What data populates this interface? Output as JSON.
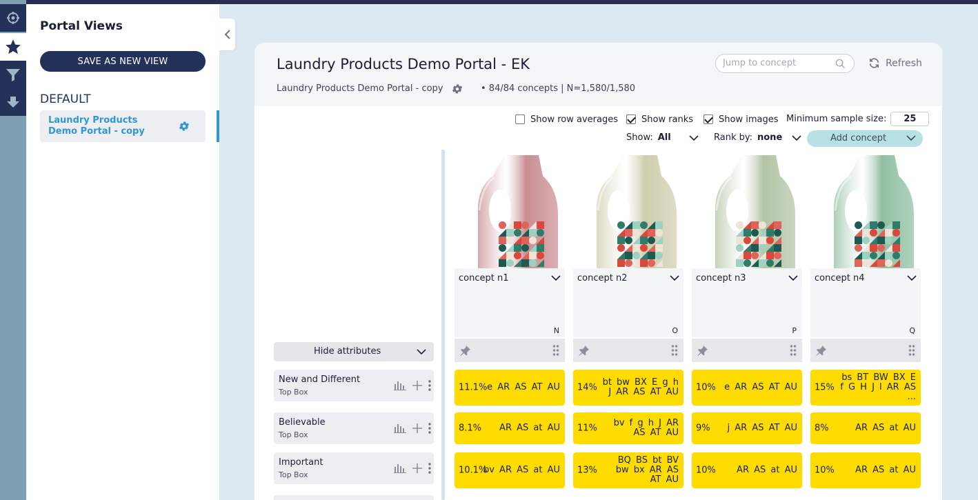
{
  "sidebar": {
    "title": "Portal Views",
    "save_button": "SAVE AS NEW VIEW",
    "group_label": "DEFAULT",
    "view_name": "Laundry Products Demo Portal - copy"
  },
  "header": {
    "title": "Laundry Products Demo Portal - EK",
    "subtitle": "Laundry Products Demo Portal - copy",
    "stats": "•  84/84 concepts | N=1,580/1,580",
    "search_placeholder": "Jump to concept",
    "refresh_label": "Refresh"
  },
  "controls": {
    "show_row_averages": {
      "label": "Show row averages",
      "checked": false
    },
    "show_ranks": {
      "label": "Show ranks",
      "checked": true
    },
    "show_images": {
      "label": "Show images",
      "checked": true
    },
    "min_sample_label": "Minimum sample size:",
    "min_sample_value": "25",
    "show_label": "Show:",
    "show_value": "All",
    "rank_label": "Rank by:",
    "rank_value": "none",
    "add_concept": "Add concept",
    "hide_attributes": "Hide attributes"
  },
  "attributes": [
    {
      "name": "New and Different",
      "sub": "Top Box"
    },
    {
      "name": "Believable",
      "sub": "Top Box"
    },
    {
      "name": "Important",
      "sub": "Top Box"
    }
  ],
  "concepts": [
    {
      "name": "concept n1",
      "letter": "N",
      "tint": "#c98d92",
      "cells": [
        {
          "pct": "11.1%",
          "letters": "e AR AS AT AU"
        },
        {
          "pct": "8.1%",
          "letters": "AR AS at AU"
        },
        {
          "pct": "10.1%",
          "letters": "bv AR AS at AU"
        }
      ]
    },
    {
      "name": "concept n2",
      "letter": "O",
      "tint": "#cfcdae",
      "cells": [
        {
          "pct": "14%",
          "letters": "bt bw BX E g h J AR AS AT AU"
        },
        {
          "pct": "11%",
          "letters": "bv f g h J AR AS AT AU"
        },
        {
          "pct": "13%",
          "letters": "BQ BS bt BV bw bx AR AS AT AU"
        }
      ]
    },
    {
      "name": "concept n3",
      "letter": "P",
      "tint": "#b2c4a4",
      "cells": [
        {
          "pct": "10%",
          "letters": "e AR AS AT AU"
        },
        {
          "pct": "9%",
          "letters": "j AR AS AT AU"
        },
        {
          "pct": "10%",
          "letters": "AR AS at AU"
        }
      ]
    },
    {
      "name": "concept n4",
      "letter": "Q",
      "tint": "#8fbfa2",
      "cells": [
        {
          "pct": "15%",
          "letters": "bs BT BW BX E f G H J l AR AS ..."
        },
        {
          "pct": "8%",
          "letters": "AR AS at AU"
        },
        {
          "pct": "10%",
          "letters": "AR AS at AU"
        }
      ]
    }
  ],
  "icons": {
    "rail": [
      "brain-icon",
      "star-icon",
      "filter-icon",
      "download-icon"
    ]
  }
}
